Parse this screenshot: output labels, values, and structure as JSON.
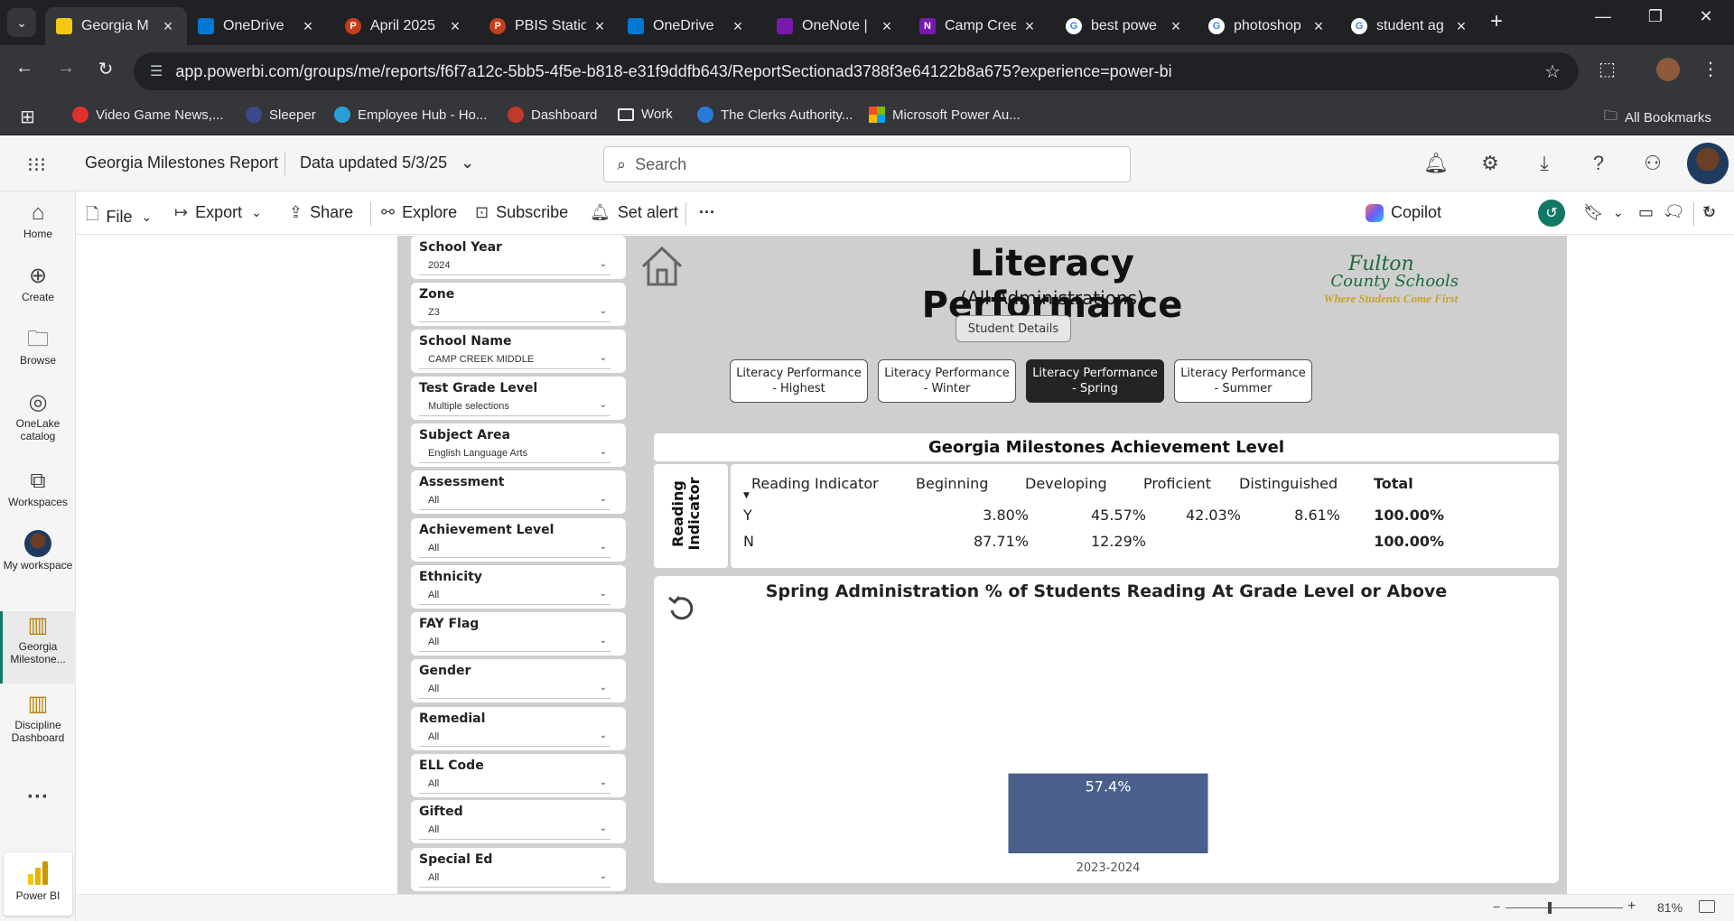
{
  "browser": {
    "tabs": [
      {
        "title": "Georgia M",
        "icon_color": "#f2c811",
        "icon": "powerbi-icon",
        "active": true
      },
      {
        "title": "OneDrive",
        "icon_color": "#0078d4",
        "icon": "onedrive-icon"
      },
      {
        "title": "April 2025",
        "icon_color": "#c43e1c",
        "icon": "powerpoint-icon"
      },
      {
        "title": "PBIS Statio",
        "icon_color": "#c43e1c",
        "icon": "powerpoint-icon"
      },
      {
        "title": "OneDrive",
        "icon_color": "#0078d4",
        "icon": "onedrive-icon"
      },
      {
        "title": "OneNote |",
        "icon_color": "#7719aa",
        "icon": "copilot-icon"
      },
      {
        "title": "Camp Cree",
        "icon_color": "#7719aa",
        "icon": "onenote-icon"
      },
      {
        "title": "best powe",
        "icon_color": "#ffffff",
        "icon": "google-icon"
      },
      {
        "title": "photoshop",
        "icon_color": "#ffffff",
        "icon": "google-icon"
      },
      {
        "title": "student ag",
        "icon_color": "#ffffff",
        "icon": "google-icon"
      }
    ],
    "url": "app.powerbi.com/groups/me/reports/f6f7a12c-5bb5-4f5e-b818-e31f9ddfb643/ReportSectionad3788f3e64122b8a675?experience=power-bi",
    "bookmarks": [
      {
        "label": "Video Game News,...",
        "color": "#e03030"
      },
      {
        "label": "Sleeper",
        "color": "#3a4a8a"
      },
      {
        "label": "Employee Hub - Ho...",
        "color": "#2aa0d8"
      },
      {
        "label": "Dashboard",
        "color": "#c0392b"
      },
      {
        "label": "Work",
        "color": "folder"
      },
      {
        "label": "The Clerks Authority...",
        "color": "#2a7bd8"
      },
      {
        "label": "Microsoft Power Au...",
        "color": "ms"
      }
    ],
    "all_bookmarks": "All Bookmarks"
  },
  "pbi_header": {
    "report_title": "Georgia Milestones Report",
    "data_updated": "Data updated 5/3/25",
    "search_placeholder": "Search"
  },
  "leftnav": [
    {
      "label": "Home",
      "icon": "home-icon"
    },
    {
      "label": "Create",
      "icon": "create-icon"
    },
    {
      "label": "Browse",
      "icon": "folder-icon"
    },
    {
      "label": "OneLake catalog",
      "icon": "onelake-icon"
    },
    {
      "label": "Workspaces",
      "icon": "workspaces-icon"
    },
    {
      "label": "My workspace",
      "icon": "avatar"
    },
    {
      "label": "Georgia Milestone...",
      "icon": "report-icon",
      "selected": true
    },
    {
      "label": "Discipline Dashboard",
      "icon": "report-icon"
    },
    {
      "label": "...",
      "icon": "more-icon"
    }
  ],
  "powerbi_label": "Power BI",
  "commands": {
    "file": "File",
    "export": "Export",
    "share": "Share",
    "explore": "Explore",
    "subscribe": "Subscribe",
    "set_alert": "Set alert",
    "more": "···",
    "copilot": "Copilot"
  },
  "slicers": [
    {
      "label": "School Year",
      "value": "2024"
    },
    {
      "label": "Zone",
      "value": "Z3"
    },
    {
      "label": "School Name",
      "value": "CAMP CREEK MIDDLE"
    },
    {
      "label": "Test Grade Level",
      "value": "Multiple selections"
    },
    {
      "label": "Subject Area",
      "value": "English Language Arts"
    },
    {
      "label": "Assessment",
      "value": "All"
    },
    {
      "label": "Achievement Level",
      "value": "All"
    },
    {
      "label": "Ethnicity",
      "value": "All"
    },
    {
      "label": "FAY Flag",
      "value": "All"
    },
    {
      "label": "Gender",
      "value": "All"
    },
    {
      "label": "Remedial",
      "value": "All"
    },
    {
      "label": "ELL Code",
      "value": "All"
    },
    {
      "label": "Gifted",
      "value": "All"
    },
    {
      "label": "Special Ed",
      "value": "All"
    }
  ],
  "report": {
    "title": "Literacy Performance",
    "subtitle": "(All Administrations)",
    "student_details": "Student Details",
    "logo_line1": "Fulton",
    "logo_line2": "County Schools",
    "logo_tagline": "Where Students Come First",
    "nav_buttons": [
      {
        "line1": "Literacy Performance",
        "line2": "- Highest",
        "active": false
      },
      {
        "line1": "Literacy Performance",
        "line2": "- Winter",
        "active": false
      },
      {
        "line1": "Literacy Performance",
        "line2": "- Spring",
        "active": true
      },
      {
        "line1": "Literacy Performance",
        "line2": "- Summer",
        "active": false
      }
    ],
    "achievement": {
      "title": "Georgia Milestones Achievement Level",
      "row_axis_label_1": "Reading",
      "row_axis_label_2": "Indicator",
      "columns": [
        "Reading Indicator",
        "Beginning",
        "Developing",
        "Proficient",
        "Distinguished",
        "Total"
      ],
      "rows": [
        {
          "label": "Y",
          "beginning": "3.80%",
          "developing": "45.57%",
          "proficient": "42.03%",
          "distinguished": "8.61%",
          "total": "100.00%"
        },
        {
          "label": "N",
          "beginning": "87.71%",
          "developing": "12.29%",
          "proficient": "",
          "distinguished": "",
          "total": "100.00%"
        }
      ]
    }
  },
  "chart_data": {
    "type": "bar",
    "title": "Spring Administration % of Students Reading At Grade Level or Above",
    "categories": [
      "2023-2024"
    ],
    "values": [
      57.4
    ],
    "data_labels": [
      "57.4%"
    ],
    "ylim": [
      0,
      100
    ],
    "bar_color": "#4a5f8c",
    "grid": false
  },
  "status": {
    "zoom": "81%"
  }
}
